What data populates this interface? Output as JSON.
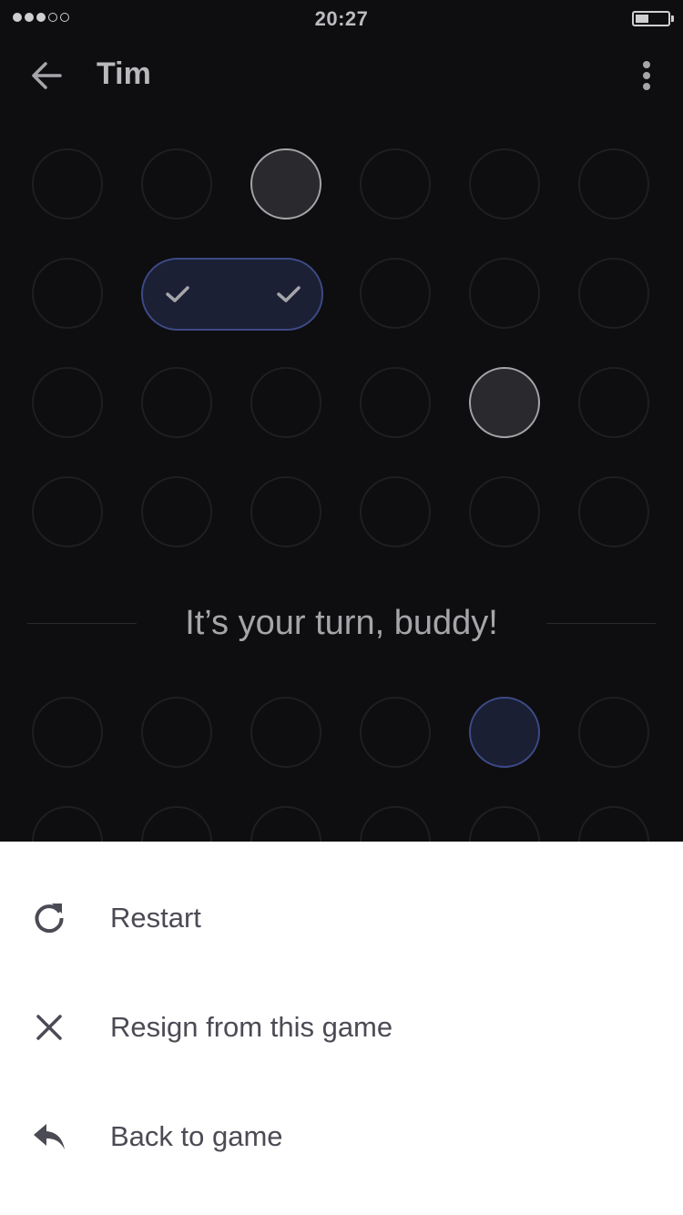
{
  "status_bar": {
    "time": "20:27",
    "signal_bars_filled": 3,
    "signal_bars_total": 5,
    "battery_level": 0.4
  },
  "header": {
    "title": "Tim",
    "back_icon": "arrow-left-icon",
    "menu_icon": "more-vertical-icon"
  },
  "game": {
    "turn_message": "It’s your turn, buddy!",
    "columns": 6,
    "rows": [
      [
        "empty",
        "empty",
        "grey",
        "empty",
        "empty",
        "empty"
      ],
      [
        "empty",
        "pill",
        "pill",
        "empty",
        "empty",
        "empty"
      ],
      [
        "empty",
        "empty",
        "empty",
        "empty",
        "grey",
        "empty"
      ],
      [
        "empty",
        "empty",
        "empty",
        "empty",
        "empty",
        "empty"
      ],
      [
        "empty",
        "empty",
        "empty",
        "empty",
        "blue",
        "empty"
      ],
      [
        "empty",
        "empty",
        "empty",
        "empty",
        "empty",
        "empty"
      ]
    ]
  },
  "menu": {
    "items": [
      {
        "label": "Restart",
        "icon": "restart-icon"
      },
      {
        "label": "Resign from this game",
        "icon": "close-icon"
      },
      {
        "label": "Back to game",
        "icon": "reply-icon"
      }
    ]
  },
  "colors": {
    "background": "#0e0e10",
    "cell_border": "#1f1f23",
    "grey_piece": "#2a2a2e",
    "grey_piece_border": "#a4a4a8",
    "blue_piece": "#1a1f33",
    "blue_piece_border": "#3d4a86",
    "sheet_background": "#ffffff",
    "sheet_text": "#4b4b55"
  }
}
